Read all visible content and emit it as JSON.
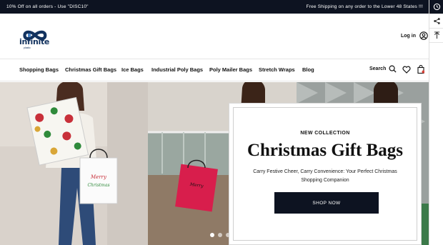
{
  "topbar": {
    "promo_text": "10% Off on all orders - Use \"DISC10\"",
    "shipping_text": "Free Shipping on any order to the Lower 48 States !!!"
  },
  "header": {
    "logo_word": "infinite",
    "logo_sub": "plastic",
    "login_label": "Log in"
  },
  "nav": {
    "items": [
      "Shopping Bags",
      "Christmas Gift Bags",
      "Ice Bags",
      "Industrial Poly Bags",
      "Poly Mailer Bags",
      "Stretch Wraps",
      "Blog"
    ],
    "search_label": "Search"
  },
  "hero": {
    "tag": "NEW COLLECTION",
    "title": "Christmas Gift Bags",
    "subtitle": "Carry Festive Cheer, Carry Convenience: Your Perfect Christmas Shopping Companion",
    "button_label": "SHOP NOW",
    "bag_text": "Merry Christmas"
  },
  "colors": {
    "dark": "#0d1321",
    "brand_blue": "#12325e",
    "red_bag": "#d81e4c"
  },
  "icons": [
    "user-icon",
    "search-icon",
    "heart-icon",
    "bag-icon",
    "history-icon",
    "share-icon",
    "arrow-up-icon"
  ]
}
